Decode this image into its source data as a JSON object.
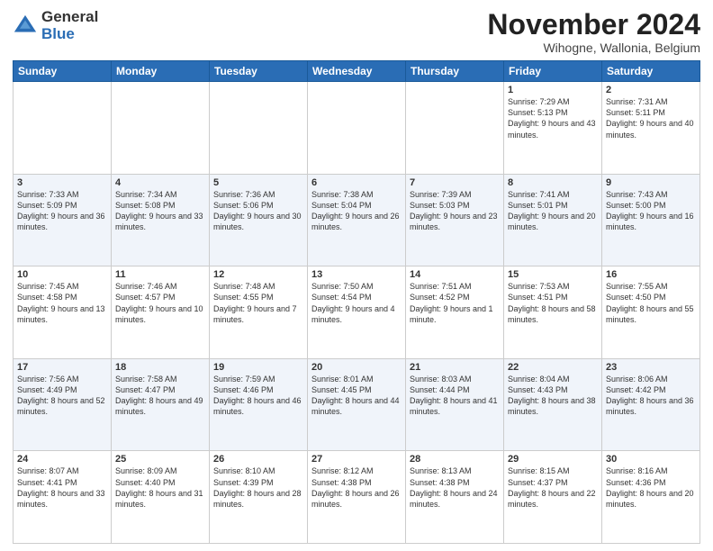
{
  "logo": {
    "general": "General",
    "blue": "Blue"
  },
  "header": {
    "month": "November 2024",
    "location": "Wihogne, Wallonia, Belgium"
  },
  "days_of_week": [
    "Sunday",
    "Monday",
    "Tuesday",
    "Wednesday",
    "Thursday",
    "Friday",
    "Saturday"
  ],
  "weeks": [
    [
      {
        "day": "",
        "info": ""
      },
      {
        "day": "",
        "info": ""
      },
      {
        "day": "",
        "info": ""
      },
      {
        "day": "",
        "info": ""
      },
      {
        "day": "",
        "info": ""
      },
      {
        "day": "1",
        "info": "Sunrise: 7:29 AM\nSunset: 5:13 PM\nDaylight: 9 hours\nand 43 minutes."
      },
      {
        "day": "2",
        "info": "Sunrise: 7:31 AM\nSunset: 5:11 PM\nDaylight: 9 hours\nand 40 minutes."
      }
    ],
    [
      {
        "day": "3",
        "info": "Sunrise: 7:33 AM\nSunset: 5:09 PM\nDaylight: 9 hours\nand 36 minutes."
      },
      {
        "day": "4",
        "info": "Sunrise: 7:34 AM\nSunset: 5:08 PM\nDaylight: 9 hours\nand 33 minutes."
      },
      {
        "day": "5",
        "info": "Sunrise: 7:36 AM\nSunset: 5:06 PM\nDaylight: 9 hours\nand 30 minutes."
      },
      {
        "day": "6",
        "info": "Sunrise: 7:38 AM\nSunset: 5:04 PM\nDaylight: 9 hours\nand 26 minutes."
      },
      {
        "day": "7",
        "info": "Sunrise: 7:39 AM\nSunset: 5:03 PM\nDaylight: 9 hours\nand 23 minutes."
      },
      {
        "day": "8",
        "info": "Sunrise: 7:41 AM\nSunset: 5:01 PM\nDaylight: 9 hours\nand 20 minutes."
      },
      {
        "day": "9",
        "info": "Sunrise: 7:43 AM\nSunset: 5:00 PM\nDaylight: 9 hours\nand 16 minutes."
      }
    ],
    [
      {
        "day": "10",
        "info": "Sunrise: 7:45 AM\nSunset: 4:58 PM\nDaylight: 9 hours\nand 13 minutes."
      },
      {
        "day": "11",
        "info": "Sunrise: 7:46 AM\nSunset: 4:57 PM\nDaylight: 9 hours\nand 10 minutes."
      },
      {
        "day": "12",
        "info": "Sunrise: 7:48 AM\nSunset: 4:55 PM\nDaylight: 9 hours\nand 7 minutes."
      },
      {
        "day": "13",
        "info": "Sunrise: 7:50 AM\nSunset: 4:54 PM\nDaylight: 9 hours\nand 4 minutes."
      },
      {
        "day": "14",
        "info": "Sunrise: 7:51 AM\nSunset: 4:52 PM\nDaylight: 9 hours\nand 1 minute."
      },
      {
        "day": "15",
        "info": "Sunrise: 7:53 AM\nSunset: 4:51 PM\nDaylight: 8 hours\nand 58 minutes."
      },
      {
        "day": "16",
        "info": "Sunrise: 7:55 AM\nSunset: 4:50 PM\nDaylight: 8 hours\nand 55 minutes."
      }
    ],
    [
      {
        "day": "17",
        "info": "Sunrise: 7:56 AM\nSunset: 4:49 PM\nDaylight: 8 hours\nand 52 minutes."
      },
      {
        "day": "18",
        "info": "Sunrise: 7:58 AM\nSunset: 4:47 PM\nDaylight: 8 hours\nand 49 minutes."
      },
      {
        "day": "19",
        "info": "Sunrise: 7:59 AM\nSunset: 4:46 PM\nDaylight: 8 hours\nand 46 minutes."
      },
      {
        "day": "20",
        "info": "Sunrise: 8:01 AM\nSunset: 4:45 PM\nDaylight: 8 hours\nand 44 minutes."
      },
      {
        "day": "21",
        "info": "Sunrise: 8:03 AM\nSunset: 4:44 PM\nDaylight: 8 hours\nand 41 minutes."
      },
      {
        "day": "22",
        "info": "Sunrise: 8:04 AM\nSunset: 4:43 PM\nDaylight: 8 hours\nand 38 minutes."
      },
      {
        "day": "23",
        "info": "Sunrise: 8:06 AM\nSunset: 4:42 PM\nDaylight: 8 hours\nand 36 minutes."
      }
    ],
    [
      {
        "day": "24",
        "info": "Sunrise: 8:07 AM\nSunset: 4:41 PM\nDaylight: 8 hours\nand 33 minutes."
      },
      {
        "day": "25",
        "info": "Sunrise: 8:09 AM\nSunset: 4:40 PM\nDaylight: 8 hours\nand 31 minutes."
      },
      {
        "day": "26",
        "info": "Sunrise: 8:10 AM\nSunset: 4:39 PM\nDaylight: 8 hours\nand 28 minutes."
      },
      {
        "day": "27",
        "info": "Sunrise: 8:12 AM\nSunset: 4:38 PM\nDaylight: 8 hours\nand 26 minutes."
      },
      {
        "day": "28",
        "info": "Sunrise: 8:13 AM\nSunset: 4:38 PM\nDaylight: 8 hours\nand 24 minutes."
      },
      {
        "day": "29",
        "info": "Sunrise: 8:15 AM\nSunset: 4:37 PM\nDaylight: 8 hours\nand 22 minutes."
      },
      {
        "day": "30",
        "info": "Sunrise: 8:16 AM\nSunset: 4:36 PM\nDaylight: 8 hours\nand 20 minutes."
      }
    ]
  ]
}
